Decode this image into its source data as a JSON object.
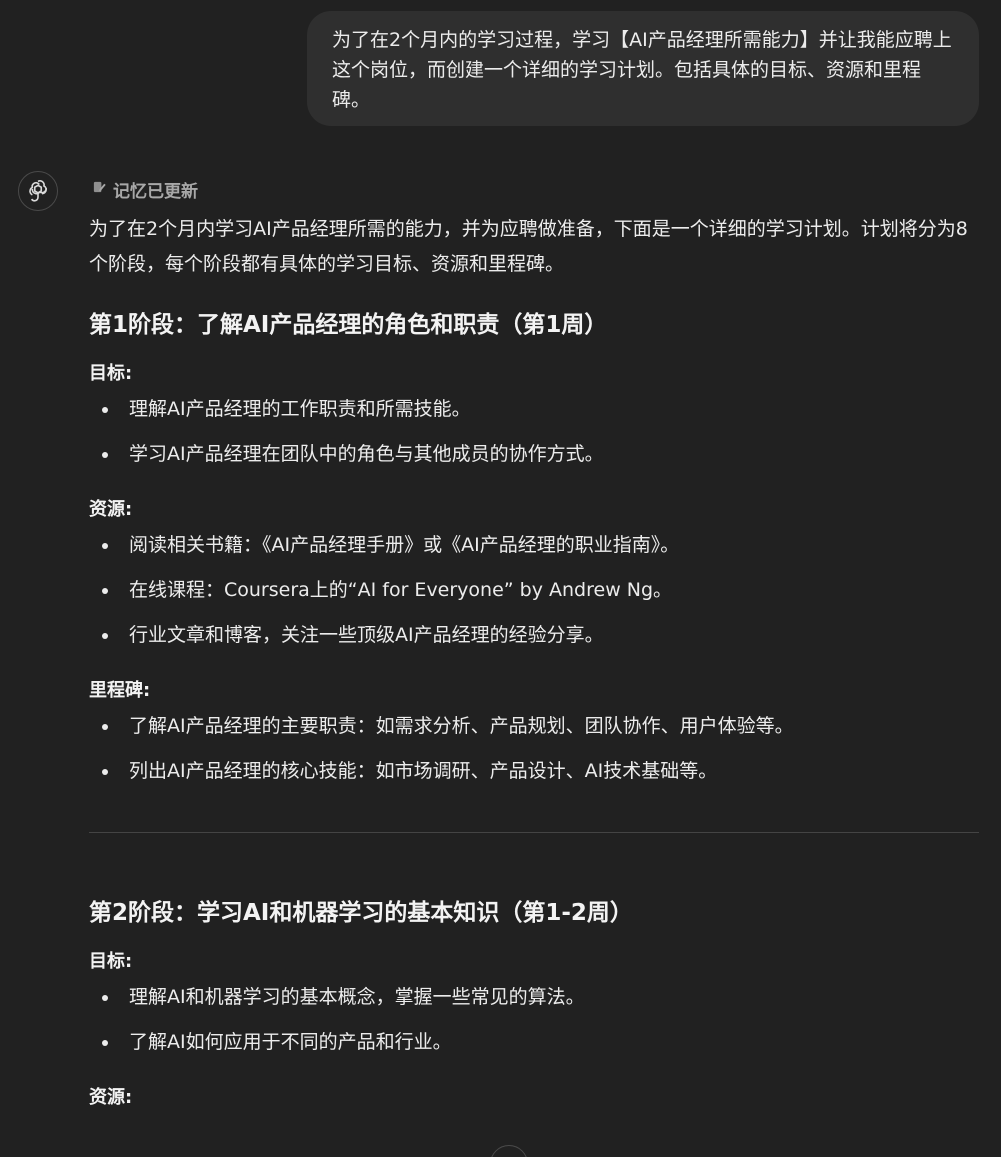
{
  "user_message": {
    "text": "为了在2个月内的学习过程，学习【AI产品经理所需能力】并让我能应聘上这个岗位，而创建一个详细的学习计划。包括具体的目标、资源和里程碑。"
  },
  "assistant": {
    "avatar_icon": "chatgpt-logo-icon",
    "memory_icon": "memory-edit-icon",
    "memory_label": "记忆已更新",
    "intro": "为了在2个月内学习AI产品经理所需的能力，并为应聘做准备，下面是一个详细的学习计划。计划将分为8个阶段，每个阶段都有具体的学习目标、资源和里程碑。",
    "stage1": {
      "title": "第1阶段：了解AI产品经理的角色和职责（第1周）",
      "goals_label": "目标:",
      "goals": [
        "理解AI产品经理的工作职责和所需技能。",
        "学习AI产品经理在团队中的角色与其他成员的协作方式。"
      ],
      "resources_label": "资源:",
      "resources": [
        "阅读相关书籍：《AI产品经理手册》或《AI产品经理的职业指南》。",
        "在线课程：Coursera上的“AI for Everyone” by Andrew Ng。",
        "行业文章和博客，关注一些顶级AI产品经理的经验分享。"
      ],
      "milestones_label": "里程碑:",
      "milestones": [
        "了解AI产品经理的主要职责：如需求分析、产品规划、团队协作、用户体验等。",
        "列出AI产品经理的核心技能：如市场调研、产品设计、AI技术基础等。"
      ]
    },
    "stage2": {
      "title": "第2阶段：学习AI和机器学习的基本知识（第1-2周）",
      "goals_label": "目标:",
      "goals": [
        "理解AI和机器学习的基本概念，掌握一些常见的算法。",
        "了解AI如何应用于不同的产品和行业。"
      ],
      "resources_label": "资源:"
    }
  },
  "scroll_down_icon": "arrow-down-icon"
}
